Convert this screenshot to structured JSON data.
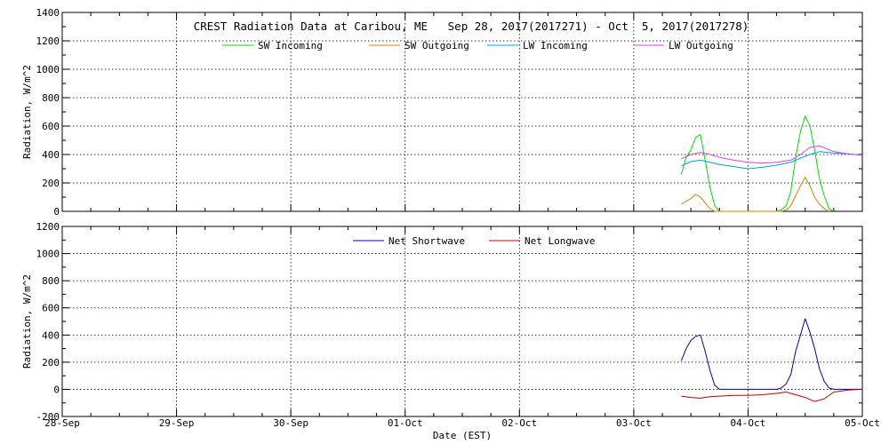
{
  "chart_data": [
    {
      "type": "line",
      "title": "CREST Radiation Data at Caribou, ME   Sep 28, 2017(2017271) - Oct  5, 2017(2017278)",
      "ylabel": "Radiation, W/m^2",
      "xlabel": "",
      "xlim": [
        "2017-09-28 00:00",
        "2017-10-05 00:00"
      ],
      "ylim": [
        0,
        1400
      ],
      "yticks": [
        0,
        200,
        400,
        600,
        800,
        1000,
        1200,
        1400
      ],
      "grid": true,
      "legend": "top-center",
      "series": [
        {
          "name": "SW Incoming",
          "color": "#00dd00",
          "x": [
            "2017-10-03 10:00",
            "2017-10-03 11:00",
            "2017-10-03 12:00",
            "2017-10-03 13:00",
            "2017-10-03 14:00",
            "2017-10-03 15:00",
            "2017-10-03 16:00",
            "2017-10-03 17:00",
            "2017-10-03 18:00",
            "2017-10-04 06:00",
            "2017-10-04 07:00",
            "2017-10-04 08:00",
            "2017-10-04 09:00",
            "2017-10-04 10:00",
            "2017-10-04 11:00",
            "2017-10-04 12:00",
            "2017-10-04 13:00",
            "2017-10-04 14:00",
            "2017-10-04 15:00",
            "2017-10-04 16:00",
            "2017-10-04 17:00",
            "2017-10-04 18:00"
          ],
          "values": [
            260,
            380,
            430,
            520,
            540,
            360,
            170,
            40,
            0,
            0,
            10,
            40,
            140,
            380,
            560,
            670,
            600,
            430,
            230,
            110,
            20,
            0
          ]
        },
        {
          "name": "SW Outgoing",
          "color": "#dd8000",
          "x": [
            "2017-10-03 10:00",
            "2017-10-03 11:00",
            "2017-10-03 12:00",
            "2017-10-03 13:00",
            "2017-10-03 14:00",
            "2017-10-03 15:00",
            "2017-10-03 16:00",
            "2017-10-03 17:00",
            "2017-10-04 07:00",
            "2017-10-04 08:00",
            "2017-10-04 09:00",
            "2017-10-04 10:00",
            "2017-10-04 11:00",
            "2017-10-04 12:00",
            "2017-10-04 13:00",
            "2017-10-04 14:00",
            "2017-10-04 15:00",
            "2017-10-04 16:00",
            "2017-10-04 17:00"
          ],
          "values": [
            50,
            70,
            90,
            120,
            100,
            60,
            20,
            0,
            0,
            10,
            40,
            110,
            180,
            240,
            180,
            100,
            50,
            20,
            0
          ]
        },
        {
          "name": "LW Incoming",
          "color": "#00a0e0",
          "x": [
            "2017-10-03 10:00",
            "2017-10-03 12:00",
            "2017-10-03 14:00",
            "2017-10-03 16:00",
            "2017-10-03 18:00",
            "2017-10-03 21:00",
            "2017-10-04 00:00",
            "2017-10-04 03:00",
            "2017-10-04 06:00",
            "2017-10-04 09:00",
            "2017-10-04 11:00",
            "2017-10-04 13:00",
            "2017-10-04 15:00",
            "2017-10-04 18:00",
            "2017-10-04 21:00",
            "2017-10-05 00:00"
          ],
          "values": [
            320,
            350,
            360,
            345,
            330,
            315,
            300,
            310,
            325,
            345,
            375,
            400,
            420,
            410,
            405,
            395
          ]
        },
        {
          "name": "LW Outgoing",
          "color": "#e040e0",
          "x": [
            "2017-10-03 10:00",
            "2017-10-03 12:00",
            "2017-10-03 14:00",
            "2017-10-03 16:00",
            "2017-10-03 18:00",
            "2017-10-03 21:00",
            "2017-10-04 00:00",
            "2017-10-04 03:00",
            "2017-10-04 06:00",
            "2017-10-04 09:00",
            "2017-10-04 11:00",
            "2017-10-04 13:00",
            "2017-10-04 15:00",
            "2017-10-04 18:00",
            "2017-10-04 21:00",
            "2017-10-05 00:00"
          ],
          "values": [
            370,
            400,
            415,
            400,
            380,
            360,
            345,
            340,
            345,
            360,
            400,
            450,
            460,
            420,
            405,
            395
          ]
        }
      ]
    },
    {
      "type": "line",
      "ylabel": "Radiation, W/m^2",
      "xlabel": "Date (EST)",
      "xlim": [
        "2017-09-28 00:00",
        "2017-10-05 00:00"
      ],
      "ylim": [
        -200,
        1200
      ],
      "yticks": [
        -200,
        0,
        200,
        400,
        600,
        800,
        1000,
        1200
      ],
      "xticks": [
        "28-Sep",
        "29-Sep",
        "30-Sep",
        "01-Oct",
        "02-Oct",
        "03-Oct",
        "04-Oct",
        "05-Oct"
      ],
      "grid": true,
      "legend": "top-center",
      "series": [
        {
          "name": "Net Shortwave",
          "color": "#0000c0",
          "x": [
            "2017-10-03 10:00",
            "2017-10-03 11:00",
            "2017-10-03 12:00",
            "2017-10-03 13:00",
            "2017-10-03 14:00",
            "2017-10-03 15:00",
            "2017-10-03 16:00",
            "2017-10-03 17:00",
            "2017-10-03 18:00",
            "2017-10-04 06:00",
            "2017-10-04 07:00",
            "2017-10-04 08:00",
            "2017-10-04 09:00",
            "2017-10-04 10:00",
            "2017-10-04 11:00",
            "2017-10-04 12:00",
            "2017-10-04 13:00",
            "2017-10-04 14:00",
            "2017-10-04 15:00",
            "2017-10-04 16:00",
            "2017-10-04 17:00",
            "2017-10-04 18:00",
            "2017-10-05 00:00"
          ],
          "values": [
            210,
            300,
            360,
            390,
            400,
            280,
            140,
            30,
            0,
            0,
            10,
            40,
            110,
            280,
            400,
            520,
            420,
            300,
            150,
            60,
            10,
            0,
            0
          ]
        },
        {
          "name": "Net Longwave",
          "color": "#c00000",
          "x": [
            "2017-10-03 10:00",
            "2017-10-03 12:00",
            "2017-10-03 14:00",
            "2017-10-03 16:00",
            "2017-10-03 18:00",
            "2017-10-03 21:00",
            "2017-10-04 00:00",
            "2017-10-04 03:00",
            "2017-10-04 06:00",
            "2017-10-04 08:00",
            "2017-10-04 10:00",
            "2017-10-04 12:00",
            "2017-10-04 14:00",
            "2017-10-04 16:00",
            "2017-10-04 18:00",
            "2017-10-04 21:00",
            "2017-10-05 00:00"
          ],
          "values": [
            -50,
            -60,
            -65,
            -55,
            -50,
            -45,
            -45,
            -40,
            -30,
            -20,
            -40,
            -60,
            -90,
            -70,
            -20,
            -5,
            0
          ]
        }
      ]
    }
  ]
}
